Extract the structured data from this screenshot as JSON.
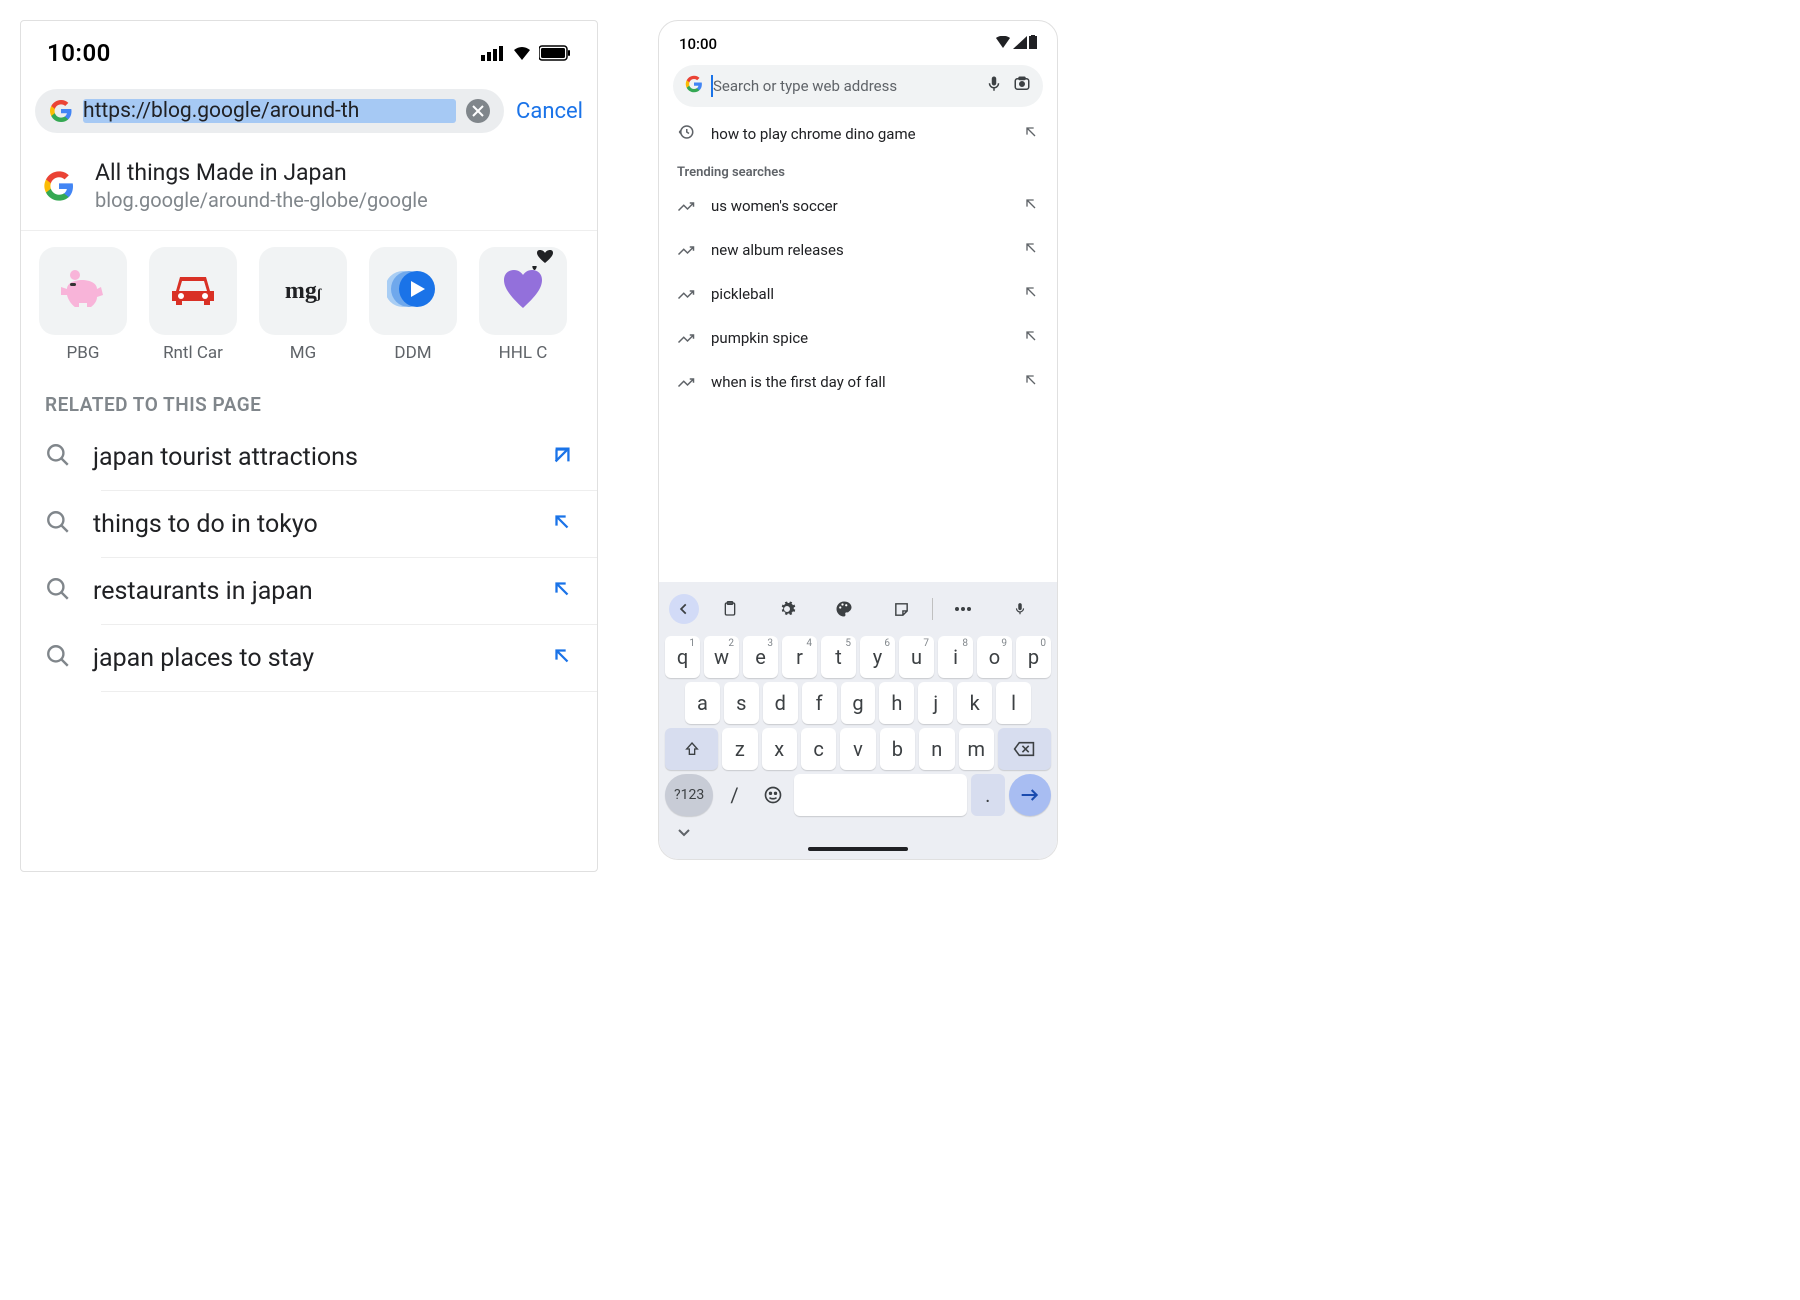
{
  "ios": {
    "status_time": "10:00",
    "omnibox": {
      "url": "https://blog.google/around-th",
      "cancel": "Cancel"
    },
    "page_result": {
      "title": "All things Made in Japan",
      "url_display": "blog.google/around-the-globe/google"
    },
    "shortcuts": [
      {
        "label": "PBG"
      },
      {
        "label": "Rntl Car"
      },
      {
        "label": "MG",
        "text": "mg"
      },
      {
        "label": "DDM"
      },
      {
        "label": "HHL C"
      }
    ],
    "section_header": "RELATED TO THIS PAGE",
    "suggestions": [
      "japan tourist attractions",
      "things to do in tokyo",
      "restaurants in japan",
      "japan places to stay"
    ]
  },
  "android": {
    "status_time": "10:00",
    "omnibox_placeholder": "Search or type web address",
    "history_item": "how to play chrome dino game",
    "trending_header": "Trending searches",
    "trending": [
      "us women's soccer",
      "new album releases",
      "pickleball",
      "pumpkin spice",
      "when is the first day of fall"
    ],
    "keyboard": {
      "row1": [
        {
          "k": "q",
          "s": "1"
        },
        {
          "k": "w",
          "s": "2"
        },
        {
          "k": "e",
          "s": "3"
        },
        {
          "k": "r",
          "s": "4"
        },
        {
          "k": "t",
          "s": "5"
        },
        {
          "k": "y",
          "s": "6"
        },
        {
          "k": "u",
          "s": "7"
        },
        {
          "k": "i",
          "s": "8"
        },
        {
          "k": "o",
          "s": "9"
        },
        {
          "k": "p",
          "s": "0"
        }
      ],
      "row2": [
        "a",
        "s",
        "d",
        "f",
        "g",
        "h",
        "j",
        "k",
        "l"
      ],
      "row3": [
        "z",
        "x",
        "c",
        "v",
        "b",
        "n",
        "m"
      ],
      "symbols_key": "?123",
      "slash_key": "/",
      "period_key": "."
    }
  }
}
